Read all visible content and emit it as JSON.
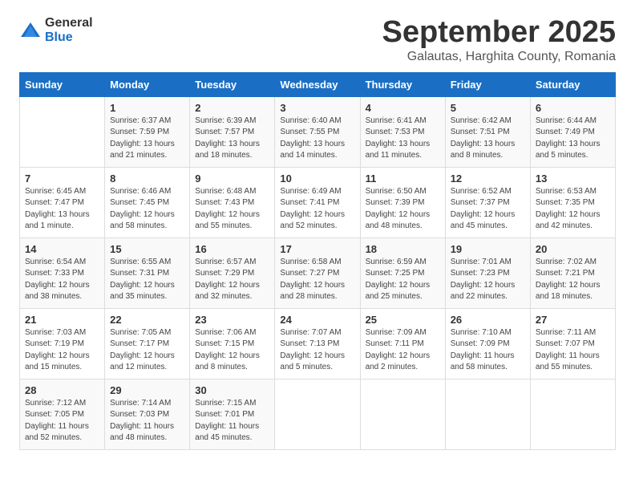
{
  "logo": {
    "text_general": "General",
    "text_blue": "Blue"
  },
  "title": "September 2025",
  "location": "Galautas, Harghita County, Romania",
  "days_of_week": [
    "Sunday",
    "Monday",
    "Tuesday",
    "Wednesday",
    "Thursday",
    "Friday",
    "Saturday"
  ],
  "weeks": [
    [
      {
        "day": "",
        "content": ""
      },
      {
        "day": "1",
        "content": "Sunrise: 6:37 AM\nSunset: 7:59 PM\nDaylight: 13 hours\nand 21 minutes."
      },
      {
        "day": "2",
        "content": "Sunrise: 6:39 AM\nSunset: 7:57 PM\nDaylight: 13 hours\nand 18 minutes."
      },
      {
        "day": "3",
        "content": "Sunrise: 6:40 AM\nSunset: 7:55 PM\nDaylight: 13 hours\nand 14 minutes."
      },
      {
        "day": "4",
        "content": "Sunrise: 6:41 AM\nSunset: 7:53 PM\nDaylight: 13 hours\nand 11 minutes."
      },
      {
        "day": "5",
        "content": "Sunrise: 6:42 AM\nSunset: 7:51 PM\nDaylight: 13 hours\nand 8 minutes."
      },
      {
        "day": "6",
        "content": "Sunrise: 6:44 AM\nSunset: 7:49 PM\nDaylight: 13 hours\nand 5 minutes."
      }
    ],
    [
      {
        "day": "7",
        "content": "Sunrise: 6:45 AM\nSunset: 7:47 PM\nDaylight: 13 hours\nand 1 minute."
      },
      {
        "day": "8",
        "content": "Sunrise: 6:46 AM\nSunset: 7:45 PM\nDaylight: 12 hours\nand 58 minutes."
      },
      {
        "day": "9",
        "content": "Sunrise: 6:48 AM\nSunset: 7:43 PM\nDaylight: 12 hours\nand 55 minutes."
      },
      {
        "day": "10",
        "content": "Sunrise: 6:49 AM\nSunset: 7:41 PM\nDaylight: 12 hours\nand 52 minutes."
      },
      {
        "day": "11",
        "content": "Sunrise: 6:50 AM\nSunset: 7:39 PM\nDaylight: 12 hours\nand 48 minutes."
      },
      {
        "day": "12",
        "content": "Sunrise: 6:52 AM\nSunset: 7:37 PM\nDaylight: 12 hours\nand 45 minutes."
      },
      {
        "day": "13",
        "content": "Sunrise: 6:53 AM\nSunset: 7:35 PM\nDaylight: 12 hours\nand 42 minutes."
      }
    ],
    [
      {
        "day": "14",
        "content": "Sunrise: 6:54 AM\nSunset: 7:33 PM\nDaylight: 12 hours\nand 38 minutes."
      },
      {
        "day": "15",
        "content": "Sunrise: 6:55 AM\nSunset: 7:31 PM\nDaylight: 12 hours\nand 35 minutes."
      },
      {
        "day": "16",
        "content": "Sunrise: 6:57 AM\nSunset: 7:29 PM\nDaylight: 12 hours\nand 32 minutes."
      },
      {
        "day": "17",
        "content": "Sunrise: 6:58 AM\nSunset: 7:27 PM\nDaylight: 12 hours\nand 28 minutes."
      },
      {
        "day": "18",
        "content": "Sunrise: 6:59 AM\nSunset: 7:25 PM\nDaylight: 12 hours\nand 25 minutes."
      },
      {
        "day": "19",
        "content": "Sunrise: 7:01 AM\nSunset: 7:23 PM\nDaylight: 12 hours\nand 22 minutes."
      },
      {
        "day": "20",
        "content": "Sunrise: 7:02 AM\nSunset: 7:21 PM\nDaylight: 12 hours\nand 18 minutes."
      }
    ],
    [
      {
        "day": "21",
        "content": "Sunrise: 7:03 AM\nSunset: 7:19 PM\nDaylight: 12 hours\nand 15 minutes."
      },
      {
        "day": "22",
        "content": "Sunrise: 7:05 AM\nSunset: 7:17 PM\nDaylight: 12 hours\nand 12 minutes."
      },
      {
        "day": "23",
        "content": "Sunrise: 7:06 AM\nSunset: 7:15 PM\nDaylight: 12 hours\nand 8 minutes."
      },
      {
        "day": "24",
        "content": "Sunrise: 7:07 AM\nSunset: 7:13 PM\nDaylight: 12 hours\nand 5 minutes."
      },
      {
        "day": "25",
        "content": "Sunrise: 7:09 AM\nSunset: 7:11 PM\nDaylight: 12 hours\nand 2 minutes."
      },
      {
        "day": "26",
        "content": "Sunrise: 7:10 AM\nSunset: 7:09 PM\nDaylight: 11 hours\nand 58 minutes."
      },
      {
        "day": "27",
        "content": "Sunrise: 7:11 AM\nSunset: 7:07 PM\nDaylight: 11 hours\nand 55 minutes."
      }
    ],
    [
      {
        "day": "28",
        "content": "Sunrise: 7:12 AM\nSunset: 7:05 PM\nDaylight: 11 hours\nand 52 minutes."
      },
      {
        "day": "29",
        "content": "Sunrise: 7:14 AM\nSunset: 7:03 PM\nDaylight: 11 hours\nand 48 minutes."
      },
      {
        "day": "30",
        "content": "Sunrise: 7:15 AM\nSunset: 7:01 PM\nDaylight: 11 hours\nand 45 minutes."
      },
      {
        "day": "",
        "content": ""
      },
      {
        "day": "",
        "content": ""
      },
      {
        "day": "",
        "content": ""
      },
      {
        "day": "",
        "content": ""
      }
    ]
  ]
}
